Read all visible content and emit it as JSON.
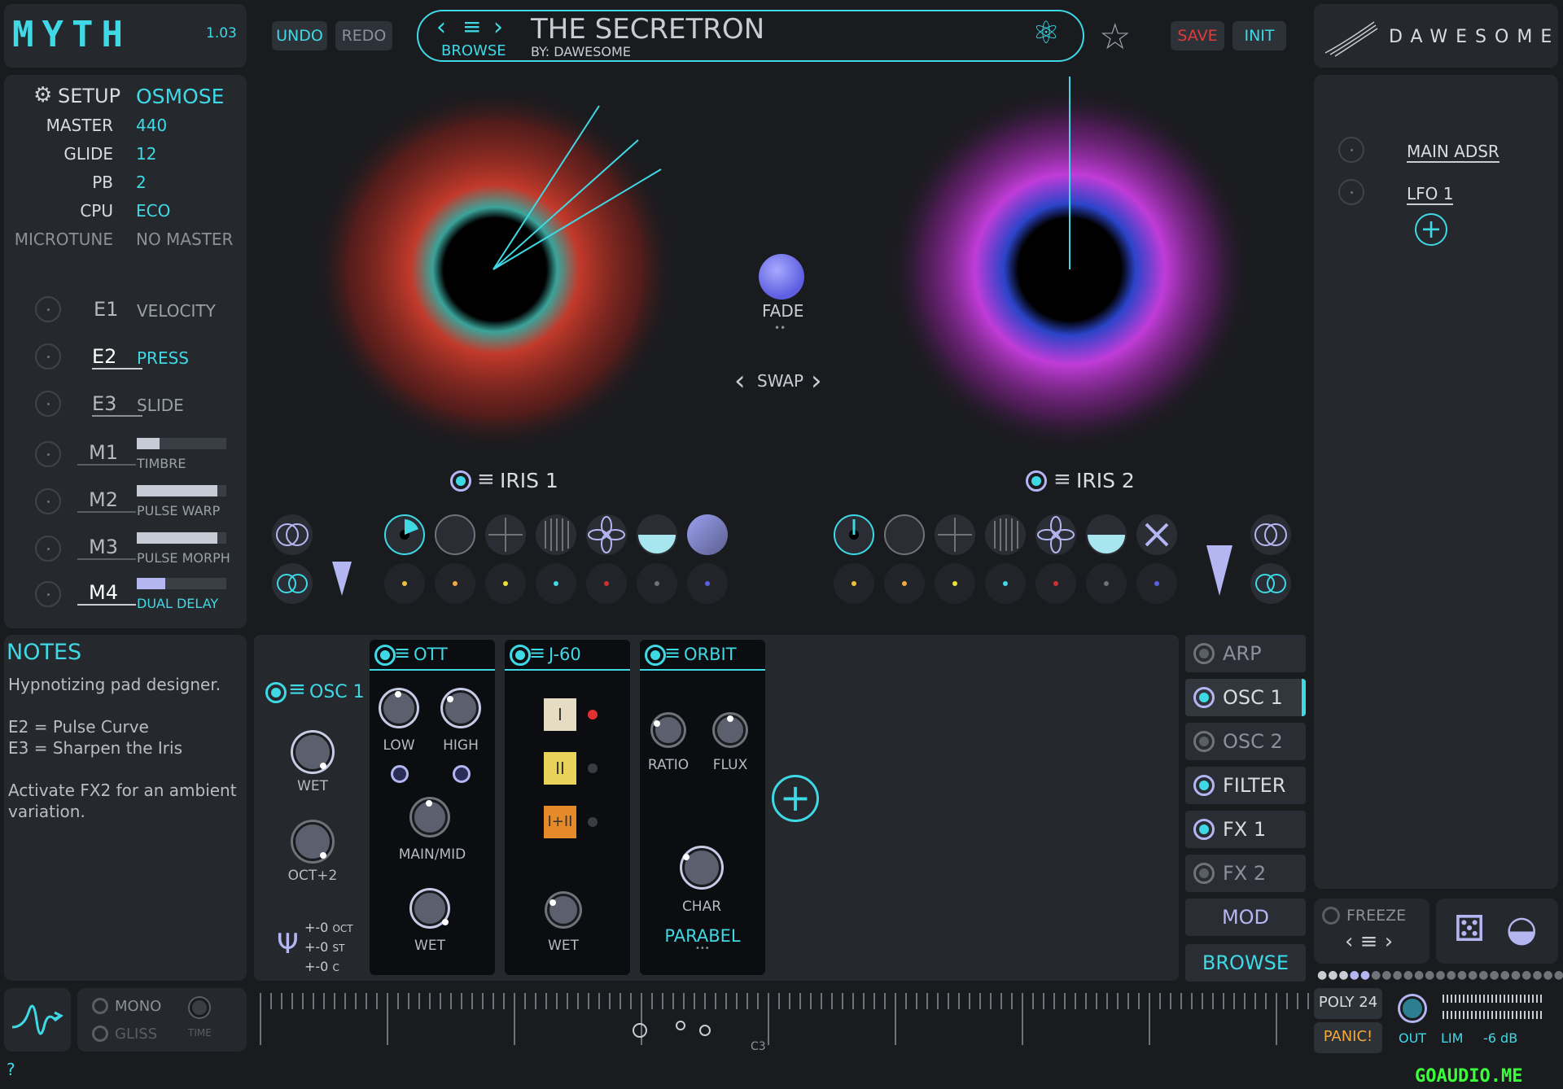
{
  "logo": {
    "name": "MYTH",
    "version": "1.03"
  },
  "toolbar": {
    "undo": "UNDO",
    "redo": "REDO",
    "save": "SAVE",
    "init": "INIT"
  },
  "preset": {
    "name": "THE SECRETRON",
    "author": "BY: DAWESOME",
    "browse_label": "BROWSE"
  },
  "brand": {
    "name": "DAWESOME"
  },
  "setup": {
    "title": "SETUP",
    "mode": "OSMOSE",
    "rows": [
      {
        "label": "MASTER",
        "value": "440"
      },
      {
        "label": "GLIDE",
        "value": "12"
      },
      {
        "label": "PB",
        "value": "2"
      },
      {
        "label": "CPU",
        "value": "ECO"
      },
      {
        "label": "MICROTUNE",
        "value": "NO MASTER"
      }
    ]
  },
  "expressions": [
    {
      "slot": "E1",
      "name": "VELOCITY"
    },
    {
      "slot": "E2",
      "name": "PRESS"
    },
    {
      "slot": "E3",
      "name": "SLIDE"
    }
  ],
  "macros": [
    {
      "slot": "M1",
      "name": "TIMBRE",
      "level": 0.25
    },
    {
      "slot": "M2",
      "name": "PULSE WARP",
      "level": 0.9
    },
    {
      "slot": "M3",
      "name": "PULSE MORPH",
      "level": 0.9
    },
    {
      "slot": "M4",
      "name": "DUAL DELAY",
      "level": 0.32
    }
  ],
  "notes": {
    "title": "NOTES",
    "lines": [
      "Hypnotizing pad designer.",
      "",
      "E2 = Pulse Curve",
      "E3 = Sharpen the Iris",
      "",
      "Activate FX2 for an ambient variation."
    ]
  },
  "center": {
    "fade": "FADE",
    "swap": "SWAP",
    "iris1": "IRIS 1",
    "iris2": "IRIS 2"
  },
  "right_mods": {
    "main_adsr": "MAIN ADSR",
    "lfo1": "LFO 1"
  },
  "osc_section": {
    "osc_label": "OSC 1",
    "wet": "WET",
    "oct": "OCT+2",
    "tune": [
      "+-0",
      "+-0",
      "+-0"
    ],
    "tune_units": [
      "OCT",
      "ST",
      "C"
    ]
  },
  "fx": {
    "ott": {
      "title": "OTT",
      "low": "LOW",
      "high": "HIGH",
      "main_mid": "MAIN/MID",
      "wet": "WET"
    },
    "j60": {
      "title": "J-60",
      "b1": "I",
      "b2": "II",
      "b3": "I+II",
      "wet": "WET"
    },
    "orbit": {
      "title": "ORBIT",
      "ratio": "RATIO",
      "flux": "FLUX",
      "char": "CHAR",
      "mode": "PARABEL"
    }
  },
  "side_tabs": {
    "arp": "ARP",
    "osc1": "OSC 1",
    "osc2": "OSC 2",
    "filter": "FILTER",
    "fx1": "FX 1",
    "fx2": "FX 2",
    "mod": "MOD",
    "browse": "BROWSE"
  },
  "bottom": {
    "freeze": "FREEZE",
    "mono": "MONO",
    "gliss": "GLISS",
    "time": "TIME",
    "poly": "POLY 24",
    "panic": "PANIC!",
    "out": "OUT",
    "lim": "LIM",
    "db": "-6 dB",
    "key_label": "C3",
    "help": "?",
    "watermark": "GOAUDIO.ME"
  },
  "colors": {
    "accent": "#3fd9e6",
    "save": "#e03c3c",
    "panic": "#f0a93a",
    "iris1": "#d23a2f",
    "iris2": "#c03cd8"
  }
}
